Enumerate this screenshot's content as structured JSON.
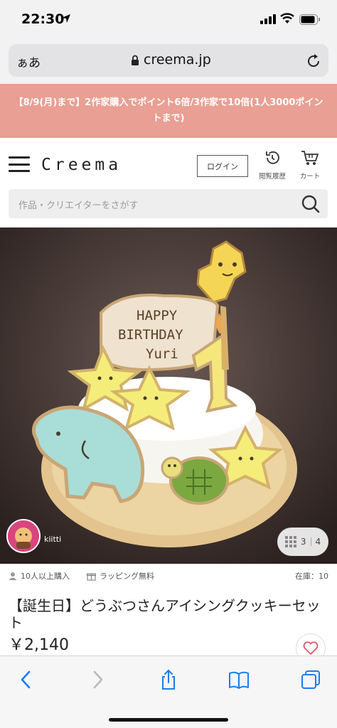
{
  "status": {
    "time": "22:30"
  },
  "browser": {
    "aa_label": "ぁあ",
    "host": "creema.jp"
  },
  "promo": {
    "text": "【8/9(月)まで】2作家購入でポイント6倍/3作家で10倍(1人3000ポイントまで)"
  },
  "header": {
    "logo": "Creema",
    "login_label": "ログイン",
    "history_label": "閲覧履歴",
    "cart_label": "カート"
  },
  "search": {
    "placeholder": "作品・クリエイターをさがす"
  },
  "gallery": {
    "creator_name": "kiitti",
    "current": "3",
    "total": "4",
    "cookie_text": [
      "HAPPY",
      "BIRTHDAY",
      "Yuri"
    ]
  },
  "product": {
    "purchases": "10人以上購入",
    "wrapping": "ラッピング無料",
    "stock": "在庫：10",
    "title": "【誕生日】どうぶつさんアイシングクッキーセット",
    "price": "￥2,140"
  },
  "colors": {
    "promo_bg": "#e99f93",
    "accent_blue": "#1a7cf5",
    "fav_heart": "#e0556e"
  },
  "icons": [
    "location-arrow-icon",
    "signal-icon",
    "wifi-icon",
    "battery-icon",
    "lock-icon",
    "reload-icon",
    "hamburger-menu-icon",
    "history-icon",
    "cart-icon",
    "search-icon",
    "user-icon",
    "gift-icon",
    "grid-icon",
    "heart-icon",
    "back-icon",
    "forward-icon",
    "share-icon",
    "bookmarks-icon",
    "tabs-icon"
  ]
}
